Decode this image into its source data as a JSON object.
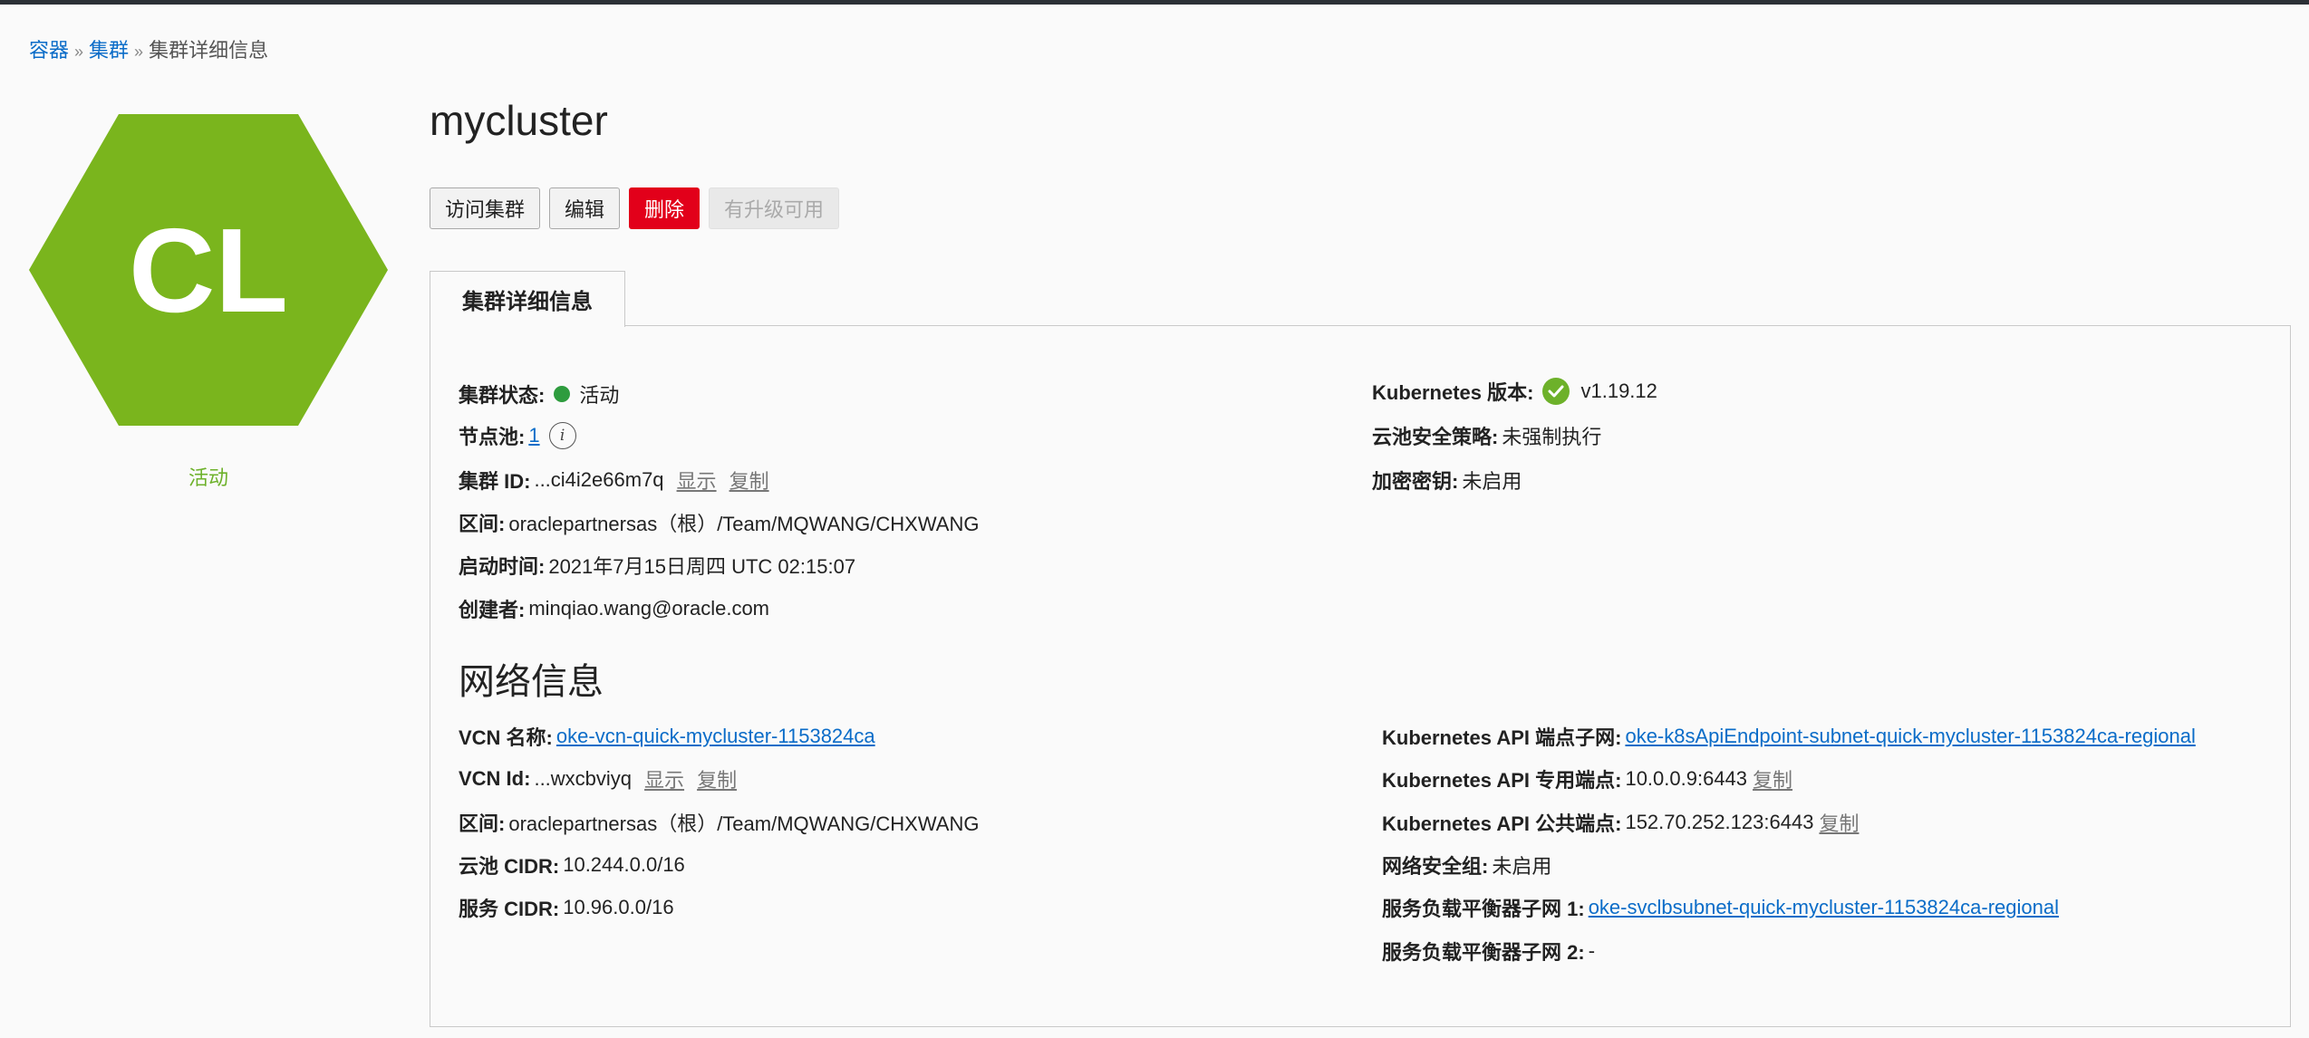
{
  "breadcrumb": {
    "item1": "容器",
    "item2": "集群",
    "current": "集群详细信息",
    "separator": "»"
  },
  "badge": {
    "initials": "CL",
    "status": "活动",
    "hex_color": "#7ab51d"
  },
  "cluster": {
    "name": "mycluster"
  },
  "actions": {
    "access": "访问集群",
    "edit": "编辑",
    "delete": "删除",
    "upgrade": "有升级可用"
  },
  "tab": {
    "label": "集群详细信息"
  },
  "details": {
    "status_label": "集群状态:",
    "status_value": "活动",
    "nodepool_label": "节点池:",
    "nodepool_value": "1",
    "id_label": "集群 ID:",
    "id_value": "...ci4i2e66m7q",
    "show": "显示",
    "copy": "复制",
    "compartment_label": "区间:",
    "compartment_value": "oraclepartnersas（根）/Team/MQWANG/CHXWANG",
    "started_label": "启动时间:",
    "started_value": "2021年7月15日周四 UTC 02:15:07",
    "creator_label": "创建者:",
    "creator_value": "minqiao.wang@oracle.com",
    "k8s_label": "Kubernetes 版本:",
    "k8s_value": "v1.19.12",
    "pod_policy_label": "云池安全策略:",
    "pod_policy_value": "未强制执行",
    "encryption_label": "加密密钥:",
    "encryption_value": "未启用"
  },
  "network": {
    "title": "网络信息",
    "vcn_name_label": "VCN 名称:",
    "vcn_name_value": "oke-vcn-quick-mycluster-1153824ca",
    "vcn_id_label": "VCN Id:",
    "vcn_id_value": "...wxcbviyq",
    "show": "显示",
    "copy": "复制",
    "compartment_label": "区间:",
    "compartment_value": "oraclepartnersas（根）/Team/MQWANG/CHXWANG",
    "pod_cidr_label": "云池 CIDR:",
    "pod_cidr_value": "10.244.0.0/16",
    "svc_cidr_label": "服务 CIDR:",
    "svc_cidr_value": "10.96.0.0/16",
    "api_subnet_label": "Kubernetes API 端点子网:",
    "api_subnet_value": "oke-k8sApiEndpoint-subnet-quick-mycluster-1153824ca-regional",
    "api_private_label": "Kubernetes API 专用端点:",
    "api_private_value": "10.0.0.9:6443",
    "api_public_label": "Kubernetes API 公共端点:",
    "api_public_value": "152.70.252.123:6443",
    "nsg_label": "网络安全组:",
    "nsg_value": "未启用",
    "lb_subnet1_label": "服务负载平衡器子网 1:",
    "lb_subnet1_value": "oke-svclbsubnet-quick-mycluster-1153824ca-regional",
    "lb_subnet2_label": "服务负载平衡器子网 2:",
    "lb_subnet2_value": "-"
  }
}
